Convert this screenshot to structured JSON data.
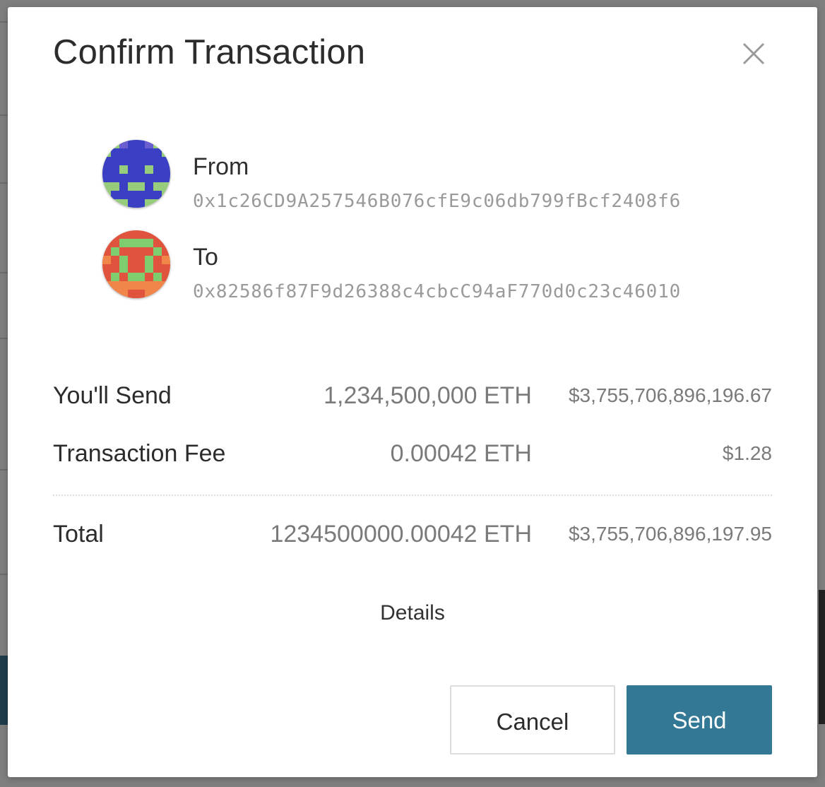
{
  "modal": {
    "title": "Confirm Transaction",
    "close_icon": "close-icon"
  },
  "from": {
    "label": "From",
    "address": "0x1c26CD9A257546B076cfE9c06db799fBcf2408f6",
    "identicon_colors": [
      "#3b3fc4",
      "#97cc7c",
      "#6b5ed0"
    ]
  },
  "to": {
    "label": "To",
    "address": "0x82586f87F9d26388c4cbcC94aF770d0c23c46010",
    "identicon_colors": [
      "#e0533c",
      "#7fce6e",
      "#f0864a"
    ]
  },
  "summary": {
    "send": {
      "label": "You'll Send",
      "eth": "1,234,500,000 ETH",
      "usd": "$3,755,706,896,196.67"
    },
    "fee": {
      "label": "Transaction Fee",
      "eth": "0.00042 ETH",
      "usd": "$1.28"
    },
    "total": {
      "label": "Total",
      "eth": "1234500000.00042 ETH",
      "usd": "$3,755,706,896,197.95"
    }
  },
  "details_label": "Details",
  "buttons": {
    "cancel": "Cancel",
    "send": "Send"
  },
  "colors": {
    "primary": "#337894",
    "overlay": "#7f7f7f"
  }
}
